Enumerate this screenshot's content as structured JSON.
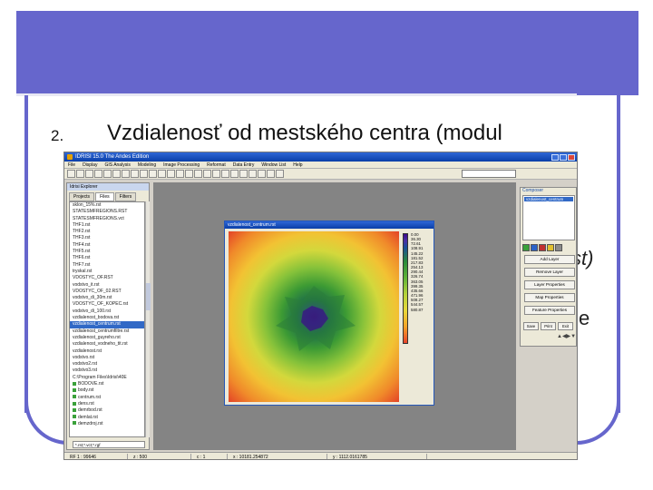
{
  "slide": {
    "accent_color": "#6666cc",
    "bullet_number": "2.",
    "bullet_text": "Vzdialenosť od mestského centra (modul",
    "right_fragment_1": "st)",
    "right_fragment_2": "e"
  },
  "app": {
    "title": "IDRISI 15.0    The Andes Edition",
    "menu": [
      "File",
      "Display",
      "GIS Analysis",
      "Modeling",
      "Image Processing",
      "Reformat",
      "Data Entry",
      "Window List",
      "Help"
    ],
    "explorer": {
      "title": "Idrisi Explorer",
      "tabs": [
        "Projects",
        "Files",
        "Filters"
      ],
      "active_tab": "Files",
      "files": [
        {
          "name": "sklon_15%.rst",
          "type": "file",
          "selected": false
        },
        {
          "name": "STATESMFREGIONS.RST",
          "type": "file",
          "selected": false
        },
        {
          "name": "STATESMFREGIONS.vct",
          "type": "file",
          "selected": false
        },
        {
          "name": "THF1.rst",
          "type": "file",
          "selected": false
        },
        {
          "name": "THF2.rst",
          "type": "file",
          "selected": false
        },
        {
          "name": "THF3.rst",
          "type": "file",
          "selected": false
        },
        {
          "name": "THF4.rst",
          "type": "file",
          "selected": false
        },
        {
          "name": "THF5.rst",
          "type": "file",
          "selected": false
        },
        {
          "name": "THF6.rst",
          "type": "file",
          "selected": false
        },
        {
          "name": "THF7.rst",
          "type": "file",
          "selected": false
        },
        {
          "name": "tryskal.rst",
          "type": "file",
          "selected": false
        },
        {
          "name": "VDOSTYC_OF.RST",
          "type": "file",
          "selected": false
        },
        {
          "name": "vodstvo_it.rst",
          "type": "file",
          "selected": false
        },
        {
          "name": "VDOSTYC_OF_02.RST",
          "type": "file",
          "selected": false
        },
        {
          "name": "vodstvo_di_30m.rst",
          "type": "file",
          "selected": false
        },
        {
          "name": "VDOSTYC_OF_KOPEC.rst",
          "type": "file",
          "selected": false
        },
        {
          "name": "vodstvo_di_100.rst",
          "type": "file",
          "selected": false
        },
        {
          "name": "vzdialenost_bodova.rst",
          "type": "file",
          "selected": false
        },
        {
          "name": "vzdialenost_centrum.rst",
          "type": "file",
          "selected": true
        },
        {
          "name": "vzdialenost_centrumfiltre.rst",
          "type": "file",
          "selected": false
        },
        {
          "name": "vzdialenost_guyreho.rst",
          "type": "file",
          "selected": false
        },
        {
          "name": "vzdialenost_vodneho_tit.rst",
          "type": "file",
          "selected": false
        },
        {
          "name": "vzdialenost.rst",
          "type": "file",
          "selected": false
        },
        {
          "name": "vodstvo.rst",
          "type": "file",
          "selected": false
        },
        {
          "name": "vodstvo2.rst",
          "type": "file",
          "selected": false
        },
        {
          "name": "vodstvo3.rst",
          "type": "file",
          "selected": false
        },
        {
          "name": "C:\\Program Files\\Idrisi\\40E",
          "type": "file",
          "selected": false
        },
        {
          "name": "BODOVE.rst",
          "type": "folder",
          "selected": false
        },
        {
          "name": "body.rst",
          "type": "folder",
          "selected": false
        },
        {
          "name": "centrum.rst",
          "type": "folder",
          "selected": false
        },
        {
          "name": "dens.rst",
          "type": "folder",
          "selected": false
        },
        {
          "name": "demrbod.rst",
          "type": "folder",
          "selected": false
        },
        {
          "name": "demlat.rst",
          "type": "folder",
          "selected": false
        },
        {
          "name": "demzdroj.rst",
          "type": "folder",
          "selected": false
        }
      ],
      "filter_value": "*.rst;*.vct;*.rgf"
    },
    "map_window": {
      "title": "vzdialenost_centrum.rst",
      "legend_values": [
        "0.00",
        "36.30",
        "72.61",
        "108.91",
        "145.22",
        "181.52",
        "217.83",
        "254.13",
        "290.44",
        "326.74",
        "363.05",
        "399.35",
        "435.66",
        "471.96",
        "508.27",
        "544.57",
        "580.87"
      ]
    },
    "composer": {
      "title": "Composer",
      "layer_name": "vzdialenost_centrum",
      "buttons": [
        "Add Layer",
        "Remove Layer",
        "Layer Properties",
        "Map Properties",
        "Feature Properties"
      ],
      "small_buttons": [
        "Save",
        "Print",
        "Exit"
      ]
    },
    "status": [
      "RF  1 : 99646",
      "z : 500",
      "c : 1",
      "x : 10181.254872",
      "y : 1112.0161785"
    ]
  }
}
